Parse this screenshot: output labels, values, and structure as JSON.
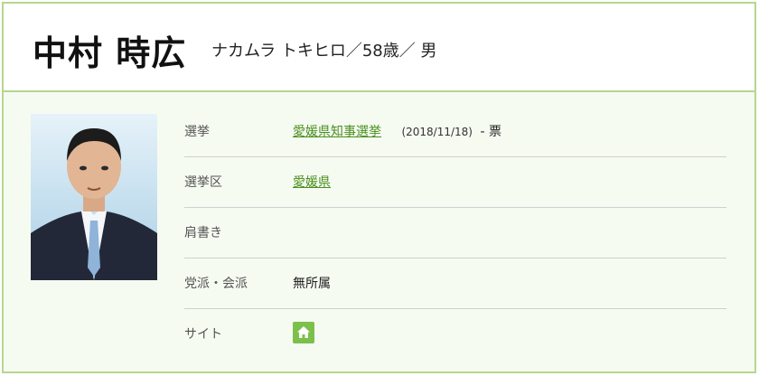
{
  "candidate": {
    "name": "中村 時広",
    "kana_age_gender": "ナカムラ トキヒロ／58歳／ 男"
  },
  "details": {
    "election": {
      "label": "選挙",
      "link": "愛媛県知事選挙",
      "date": "(2018/11/18)",
      "votes": "- 票"
    },
    "district": {
      "label": "選挙区",
      "link": "愛媛県"
    },
    "title": {
      "label": "肩書き",
      "value": ""
    },
    "party": {
      "label": "党派・会派",
      "value": "無所属"
    },
    "site": {
      "label": "サイト",
      "icon": "home-icon"
    }
  },
  "colors": {
    "border": "#b5d78f",
    "link": "#4a8f1e",
    "icon_bg": "#7cc04c",
    "panel_bg": "#f6fbf2"
  }
}
